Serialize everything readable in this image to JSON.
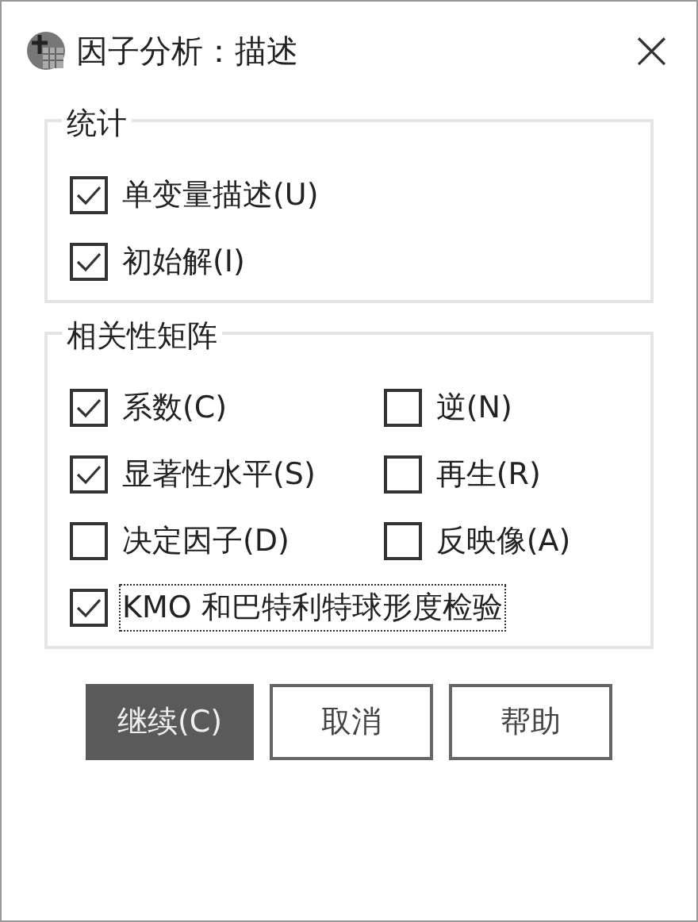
{
  "window": {
    "title": "因子分析：描述",
    "close": "×"
  },
  "groups": [
    {
      "title": "统计",
      "rows": [
        [
          {
            "label": "单变量描述(U)",
            "checked": true,
            "focused": false
          }
        ],
        [
          {
            "label": "初始解(I)",
            "checked": true,
            "focused": false
          }
        ]
      ]
    },
    {
      "title": "相关性矩阵",
      "rows": [
        [
          {
            "label": "系数(C)",
            "checked": true,
            "focused": false
          },
          {
            "label": "逆(N)",
            "checked": false,
            "focused": false
          }
        ],
        [
          {
            "label": "显著性水平(S)",
            "checked": true,
            "focused": false
          },
          {
            "label": "再生(R)",
            "checked": false,
            "focused": false
          }
        ],
        [
          {
            "label": "决定因子(D)",
            "checked": false,
            "focused": false
          },
          {
            "label": "反映像(A)",
            "checked": false,
            "focused": false
          }
        ],
        [
          {
            "label": "KMO 和巴特利特球形度检验",
            "checked": true,
            "focused": true
          }
        ]
      ]
    }
  ],
  "buttons": [
    {
      "label": "继续(C)",
      "default": true
    },
    {
      "label": "取消",
      "default": false
    },
    {
      "label": "帮助",
      "default": false
    }
  ]
}
